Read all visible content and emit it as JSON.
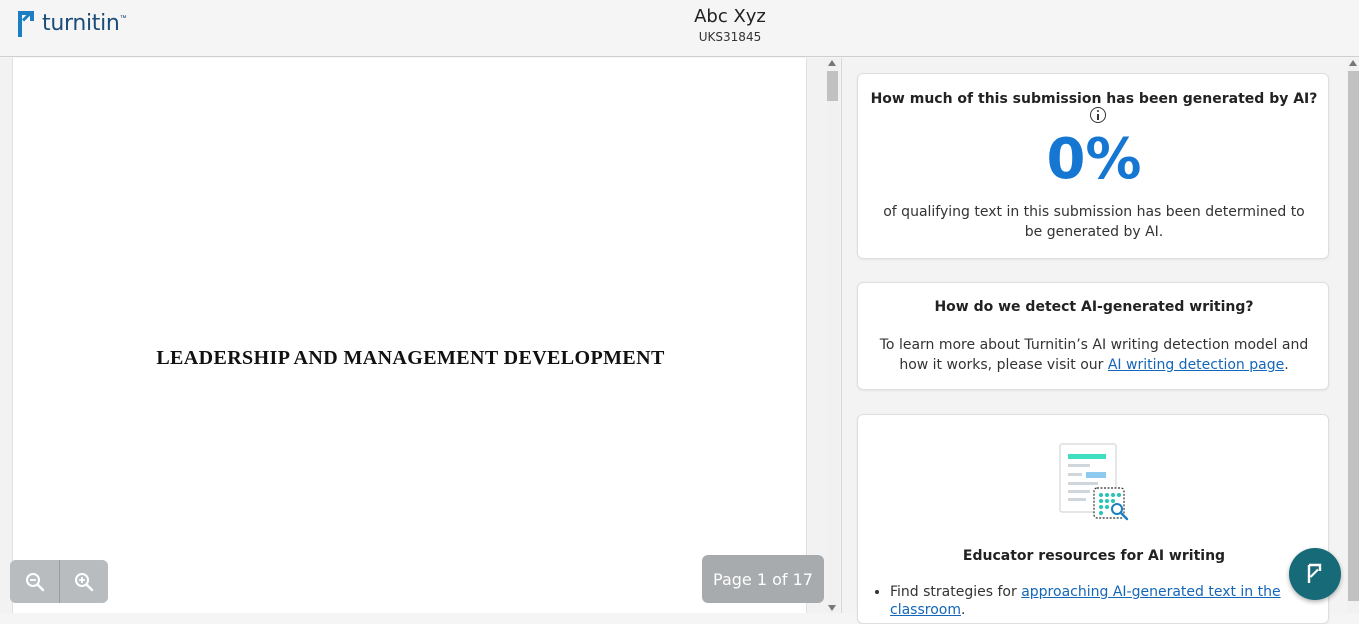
{
  "header": {
    "logo_text": "turnitin",
    "student_name": "Abc Xyz",
    "submission_id": "UKS31845"
  },
  "document": {
    "title": "LEADERSHIP AND MANAGEMENT DEVELOPMENT",
    "page_indicator": "Page 1 of 17",
    "zoom_out_icon": "zoom-out-icon",
    "zoom_in_icon": "zoom-in-icon"
  },
  "ai_panel": {
    "question": "How much of this submission has been generated by AI?",
    "percentage": "0%",
    "description": "of qualifying text in this submission has been determined to be generated by AI.",
    "detect_title": "How do we detect AI-generated writing?",
    "detect_text_before": "To learn more about Turnitin’s AI writing detection model and how it works, please visit our ",
    "detect_link": "AI writing detection page",
    "detect_text_after": ".",
    "resources_title": "Educator resources for AI writing",
    "resources_item_prefix": "Find strategies for ",
    "resources_item_link": "approaching AI-generated text in the classroom",
    "resources_item_suffix": "."
  },
  "colors": {
    "accent": "#1577d2",
    "brand": "#1b7ec2",
    "fab": "#176a78"
  }
}
